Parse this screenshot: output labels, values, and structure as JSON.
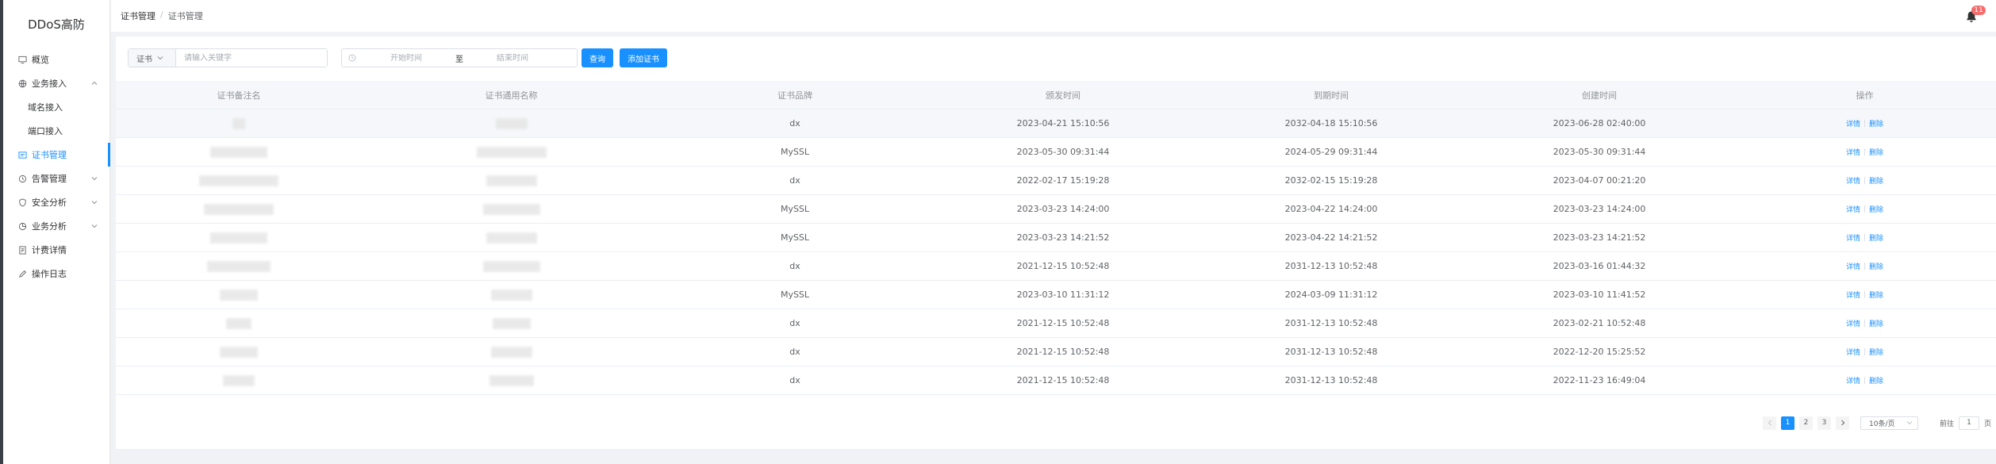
{
  "app": {
    "title": "DDoS高防"
  },
  "sidebar": {
    "items": [
      {
        "label": "概览",
        "icon": "monitor-icon"
      },
      {
        "label": "业务接入",
        "icon": "globe-icon",
        "expanded": true
      },
      {
        "label": "域名接入",
        "sub": true
      },
      {
        "label": "端口接入",
        "sub": true
      },
      {
        "label": "证书管理",
        "icon": "certificate-icon",
        "active": true
      },
      {
        "label": "告警管理",
        "icon": "alarm-icon",
        "has_children": true
      },
      {
        "label": "安全分析",
        "icon": "shield-icon",
        "has_children": true
      },
      {
        "label": "业务分析",
        "icon": "analytics-icon",
        "has_children": true
      },
      {
        "label": "计费详情",
        "icon": "billing-icon"
      },
      {
        "label": "操作日志",
        "icon": "edit-icon"
      }
    ]
  },
  "header": {
    "breadcrumb": [
      "证书管理",
      "证书管理"
    ],
    "notification_count": "11"
  },
  "filter": {
    "select_value": "证书",
    "keyword_placeholder": "请输入关键字",
    "start_placeholder": "开始时间",
    "range_separator": "至",
    "end_placeholder": "结束时间",
    "query_label": "查询",
    "add_label": "添加证书"
  },
  "table": {
    "columns": [
      "证书备注名",
      "证书通用名称",
      "证书品牌",
      "颁发时间",
      "到期时间",
      "创建时间",
      "操作"
    ],
    "rows": [
      {
        "brand": "dx",
        "issued": "2023-04-21 15:10:56",
        "expires": "2032-04-18 15:10:56",
        "created": "2023-06-28 02:40:00"
      },
      {
        "brand": "MySSL",
        "issued": "2023-05-30 09:31:44",
        "expires": "2024-05-29 09:31:44",
        "created": "2023-05-30 09:31:44"
      },
      {
        "brand": "dx",
        "issued": "2022-02-17 15:19:28",
        "expires": "2032-02-15 15:19:28",
        "created": "2023-04-07 00:21:20"
      },
      {
        "brand": "MySSL",
        "issued": "2023-03-23 14:24:00",
        "expires": "2023-04-22 14:24:00",
        "created": "2023-03-23 14:24:00"
      },
      {
        "brand": "MySSL",
        "issued": "2023-03-23 14:21:52",
        "expires": "2023-04-22 14:21:52",
        "created": "2023-03-23 14:21:52"
      },
      {
        "brand": "dx",
        "issued": "2021-12-15 10:52:48",
        "expires": "2031-12-13 10:52:48",
        "created": "2023-03-16 01:44:32"
      },
      {
        "brand": "MySSL",
        "issued": "2023-03-10 11:31:12",
        "expires": "2024-03-09 11:31:12",
        "created": "2023-03-10 11:41:52"
      },
      {
        "brand": "dx",
        "issued": "2021-12-15 10:52:48",
        "expires": "2031-12-13 10:52:48",
        "created": "2023-02-21 10:52:48"
      },
      {
        "brand": "dx",
        "issued": "2021-12-15 10:52:48",
        "expires": "2031-12-13 10:52:48",
        "created": "2022-12-20 15:25:52"
      },
      {
        "brand": "dx",
        "issued": "2021-12-15 10:52:48",
        "expires": "2031-12-13 10:52:48",
        "created": "2022-11-23 16:49:04"
      }
    ],
    "action_detail": "详情",
    "action_delete": "删除"
  },
  "pagination": {
    "pages": [
      "1",
      "2",
      "3"
    ],
    "current": "1",
    "page_size_label": "10条/页",
    "goto_label": "前往",
    "goto_value": "1",
    "page_suffix": "页"
  },
  "colors": {
    "accent": "#1890ff",
    "badge": "#f56c6c"
  }
}
